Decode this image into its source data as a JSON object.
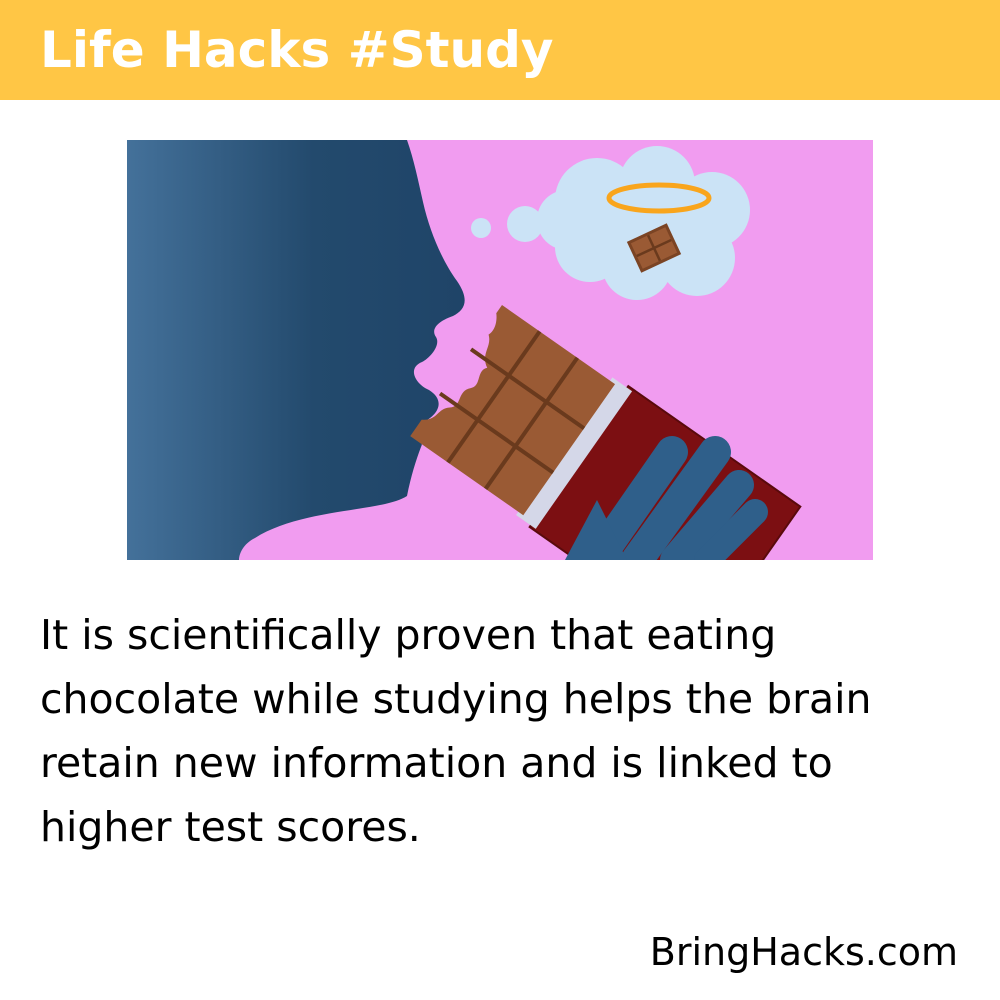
{
  "header": {
    "title": "Life Hacks #Study",
    "background_color": "#ffc645",
    "text_color": "#ffffff"
  },
  "illustration": {
    "icons": [
      "person-silhouette-icon",
      "chocolate-bar-icon",
      "thought-cloud-icon",
      "halo-icon",
      "chocolate-piece-icon",
      "hand-icon"
    ],
    "background_color": "#f19cf0"
  },
  "body": {
    "text": "It is scientifically proven that eating chocolate while studying helps the brain retain new information and is linked to higher test scores."
  },
  "footer": {
    "site": "BringHacks.com"
  }
}
